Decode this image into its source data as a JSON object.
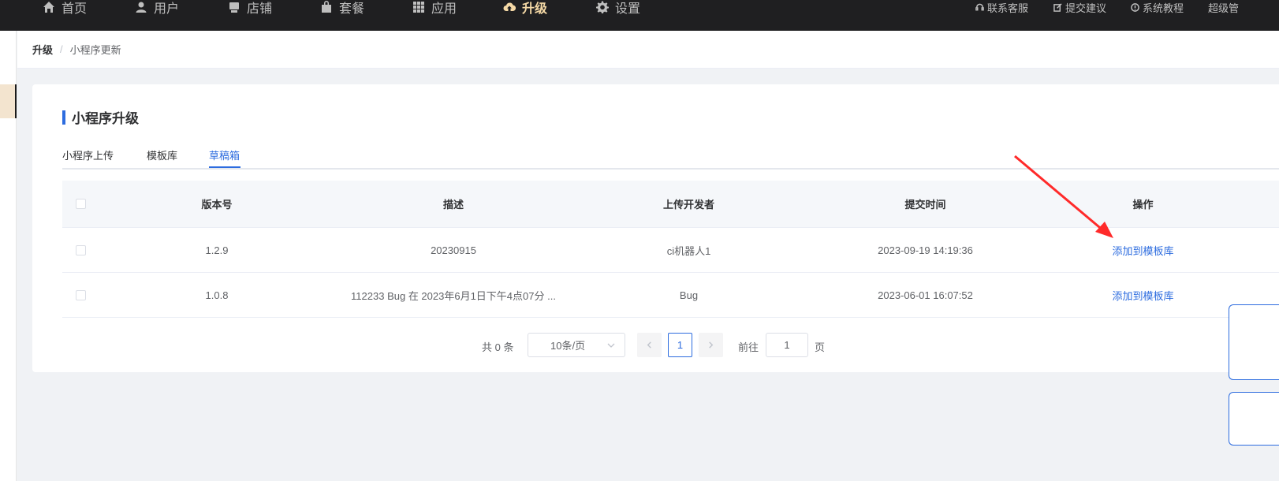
{
  "nav": {
    "items": [
      {
        "label": "首页",
        "icon": "home-icon",
        "active": false
      },
      {
        "label": "用户",
        "icon": "user-icon",
        "active": false
      },
      {
        "label": "店铺",
        "icon": "shop-icon",
        "active": false
      },
      {
        "label": "套餐",
        "icon": "package-icon",
        "active": false
      },
      {
        "label": "应用",
        "icon": "grid-icon",
        "active": false
      },
      {
        "label": "升级",
        "icon": "cloud-upload-icon",
        "active": true
      },
      {
        "label": "设置",
        "icon": "gear-icon",
        "active": false
      }
    ],
    "right": [
      {
        "label": "联系客服",
        "icon": "headset-icon"
      },
      {
        "label": "提交建议",
        "icon": "edit-icon"
      },
      {
        "label": "系统教程",
        "icon": "tutorial-icon"
      },
      {
        "label": "超级管",
        "icon": ""
      }
    ]
  },
  "breadcrumb": {
    "root": "升级",
    "separator": "/",
    "current": "小程序更新"
  },
  "card": {
    "title": "小程序升级",
    "tabs": [
      {
        "label": "小程序上传",
        "active": false
      },
      {
        "label": "模板库",
        "active": false
      },
      {
        "label": "草稿箱",
        "active": true
      }
    ]
  },
  "table": {
    "headers": [
      "版本号",
      "描述",
      "上传开发者",
      "提交时间",
      "操作"
    ],
    "rows": [
      {
        "version": "1.2.9",
        "desc": "20230915",
        "developer": "ci机器人1",
        "time": "2023-09-19 14:19:36",
        "action": "添加到模板库"
      },
      {
        "version": "1.0.8",
        "desc": "112233 Bug 在 2023年6月1日下午4点07分 ...",
        "developer": "Bug",
        "time": "2023-06-01 16:07:52",
        "action": "添加到模板库"
      }
    ]
  },
  "pagination": {
    "total": "共 0 条",
    "page_size": "10条/页",
    "current_page": "1",
    "goto_label": "前往",
    "goto_value": "1",
    "page_suffix": "页"
  },
  "colors": {
    "accent": "#2d6cdf",
    "nav_bg": "#1f1f21",
    "nav_active": "#f5d9a6",
    "annotation": "#ff2a2a"
  }
}
